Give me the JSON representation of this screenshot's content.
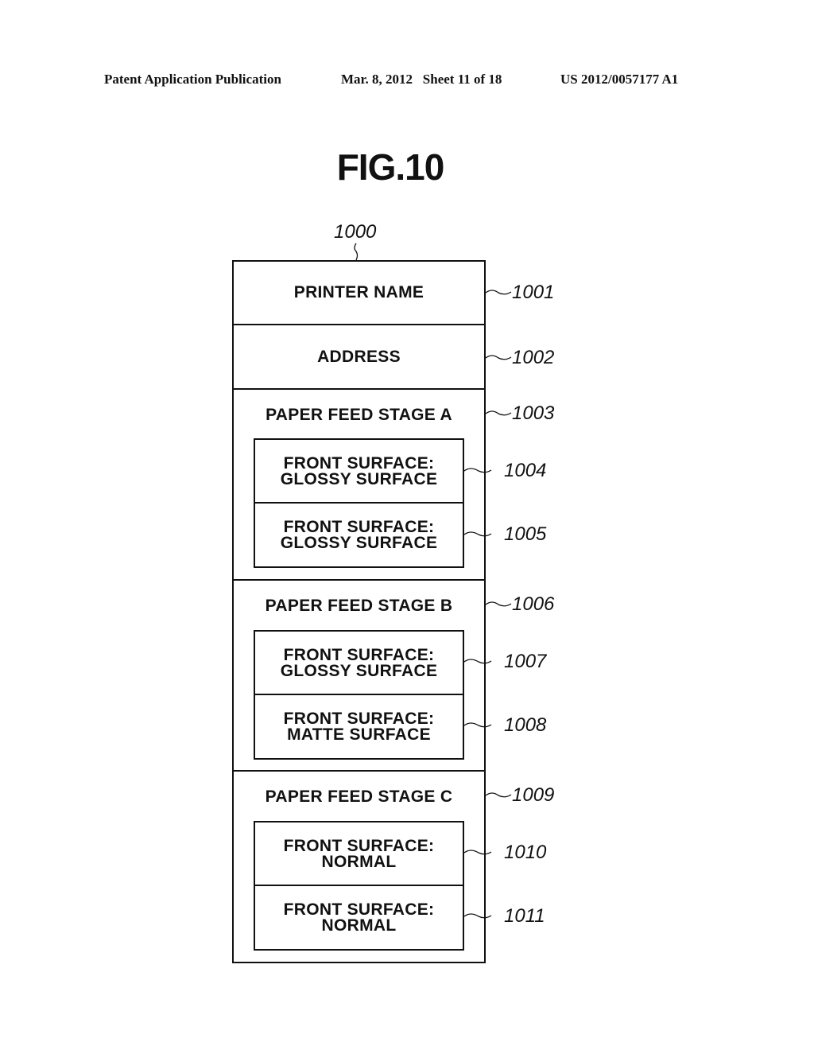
{
  "header": {
    "publication": "Patent Application Publication",
    "date_sheet": "Mar. 8, 2012   Sheet 11 of 18",
    "patent_number": "US 2012/0057177 A1"
  },
  "figure": {
    "title": "FIG.10",
    "outer_ref": "1000",
    "rows": [
      {
        "label": "PRINTER NAME",
        "ref": "1001"
      },
      {
        "label": "ADDRESS",
        "ref": "1002"
      }
    ],
    "stages": [
      {
        "label": "PAPER FEED STAGE A",
        "ref": "1003",
        "entries": [
          {
            "line1": "FRONT SURFACE:",
            "line2": "GLOSSY SURFACE",
            "ref": "1004"
          },
          {
            "line1": "FRONT SURFACE:",
            "line2": "GLOSSY SURFACE",
            "ref": "1005"
          }
        ]
      },
      {
        "label": "PAPER FEED STAGE B",
        "ref": "1006",
        "entries": [
          {
            "line1": "FRONT SURFACE:",
            "line2": "GLOSSY SURFACE",
            "ref": "1007"
          },
          {
            "line1": "FRONT SURFACE:",
            "line2": "MATTE SURFACE",
            "ref": "1008"
          }
        ]
      },
      {
        "label": "PAPER FEED STAGE C",
        "ref": "1009",
        "entries": [
          {
            "line1": "FRONT SURFACE:",
            "line2": "NORMAL",
            "ref": "1010"
          },
          {
            "line1": "FRONT SURFACE:",
            "line2": "NORMAL",
            "ref": "1011"
          }
        ]
      }
    ]
  }
}
